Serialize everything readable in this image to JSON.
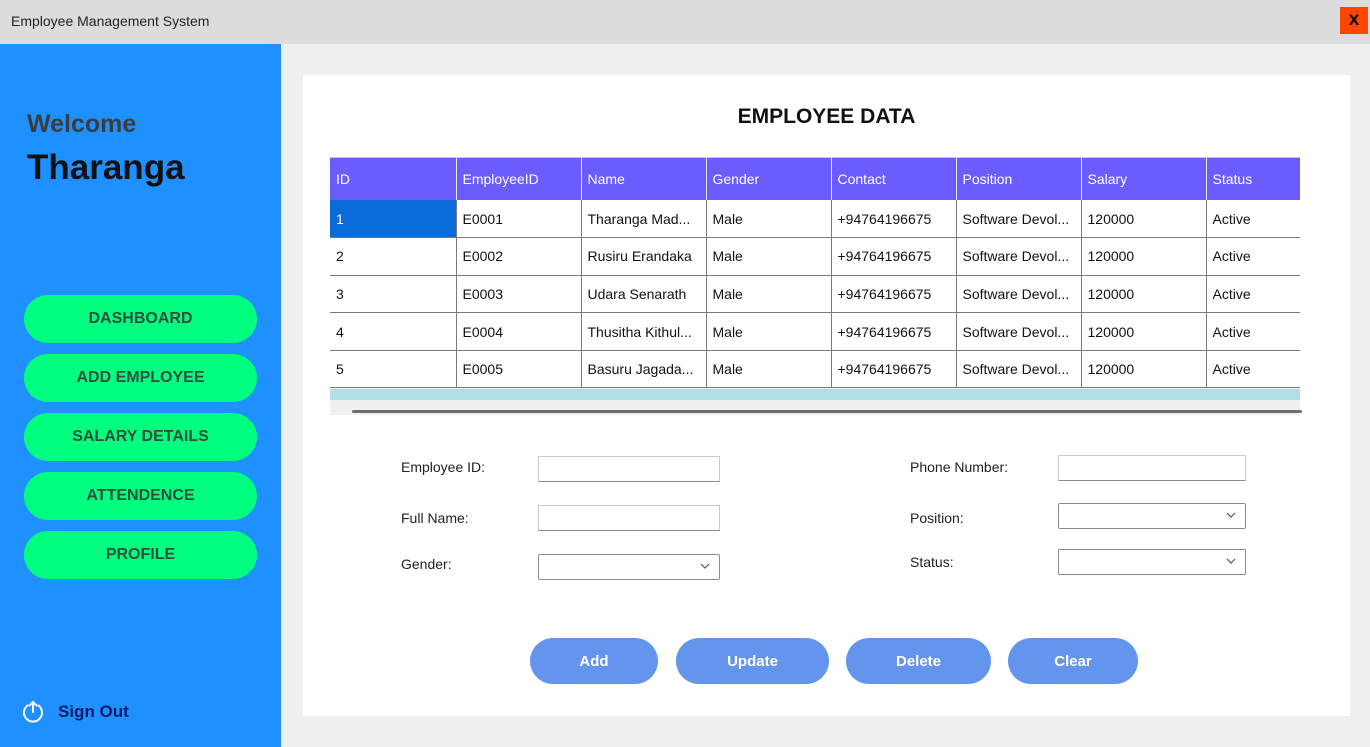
{
  "window": {
    "title": "Employee Management System",
    "close_label": "X"
  },
  "sidebar": {
    "welcome": "Welcome",
    "username": "Tharanga",
    "nav": [
      {
        "label": "DASHBOARD"
      },
      {
        "label": "ADD EMPLOYEE"
      },
      {
        "label": "SALARY DETAILS"
      },
      {
        "label": "ATTENDENCE"
      },
      {
        "label": "PROFILE"
      }
    ],
    "signout": {
      "label": "Sign Out",
      "icon": "power-icon"
    }
  },
  "main": {
    "title": "EMPLOYEE DATA",
    "table": {
      "columns": [
        "ID",
        "EmployeeID",
        "Name",
        "Gender",
        "Contact",
        "Position",
        "Salary",
        "Status"
      ],
      "rows": [
        [
          "1",
          "E0001",
          "Tharanga Mad...",
          "Male",
          "+94764196675",
          "Software Devol...",
          "120000",
          "Active"
        ],
        [
          "2",
          "E0002",
          "Rusiru Erandaka",
          "Male",
          "+94764196675",
          "Software Devol...",
          "120000",
          "Active"
        ],
        [
          "3",
          "E0003",
          "Udara Senarath",
          "Male",
          "+94764196675",
          "Software Devol...",
          "120000",
          "Active"
        ],
        [
          "4",
          "E0004",
          "Thusitha Kithul...",
          "Male",
          "+94764196675",
          "Software Devol...",
          "120000",
          "Active"
        ],
        [
          "5",
          "E0005",
          "Basuru Jagada...",
          "Male",
          "+94764196675",
          "Software Devol...",
          "120000",
          "Active"
        ]
      ],
      "selected_cell": "1"
    },
    "form": {
      "employee_id": {
        "label": "Employee ID:",
        "value": ""
      },
      "full_name": {
        "label": "Full Name:",
        "value": ""
      },
      "gender": {
        "label": "Gender:",
        "value": ""
      },
      "phone": {
        "label": "Phone Number:",
        "value": ""
      },
      "position": {
        "label": "Position:",
        "value": ""
      },
      "status": {
        "label": "Status:",
        "value": ""
      }
    },
    "actions": {
      "add": "Add",
      "update": "Update",
      "delete": "Delete",
      "clear": "Clear"
    }
  },
  "colors": {
    "sidebar_bg": "#1e90ff",
    "nav_button": "#00ff7f",
    "table_header": "#6a5cff",
    "selected_cell": "#0a6cd8",
    "action_button": "#6495ed",
    "close_button": "#ff4500"
  }
}
